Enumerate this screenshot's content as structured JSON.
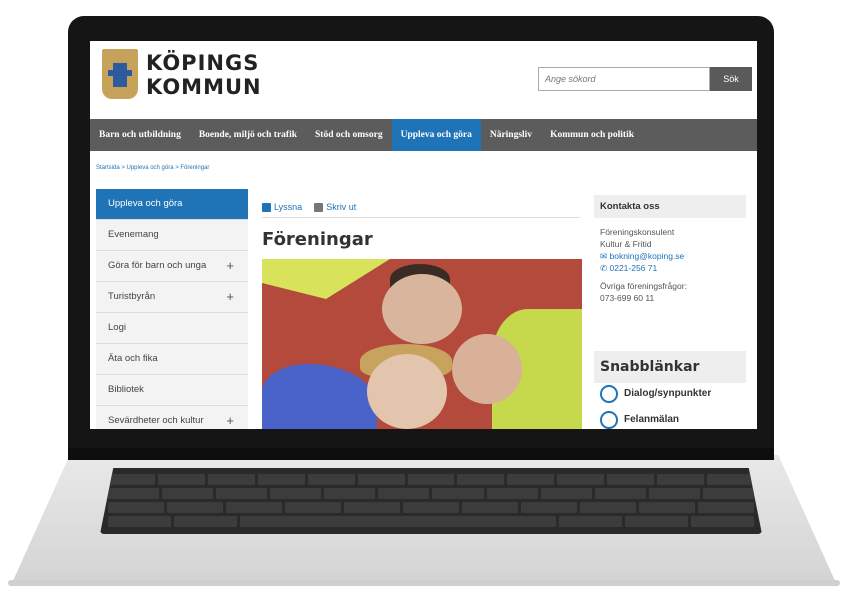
{
  "header": {
    "logo_line1": "KÖPINGS",
    "logo_line2": "KOMMUN",
    "search_placeholder": "Ange sökord",
    "search_button": "Sök"
  },
  "nav": [
    {
      "label": "Barn och utbildning",
      "active": false
    },
    {
      "label": "Boende, miljö och trafik",
      "active": false
    },
    {
      "label": "Stöd och omsorg",
      "active": false
    },
    {
      "label": "Uppleva och göra",
      "active": true
    },
    {
      "label": "Näringsliv",
      "active": false
    },
    {
      "label": "Kommun och politik",
      "active": false
    }
  ],
  "breadcrumb": "Startsida > Uppleva och göra > Föreningar",
  "sidebar": [
    {
      "label": "Uppleva och göra",
      "active": true,
      "expand": false
    },
    {
      "label": "Evenemang",
      "active": false,
      "expand": false
    },
    {
      "label": "Göra för barn och unga",
      "active": false,
      "expand": true
    },
    {
      "label": "Turistbyrån",
      "active": false,
      "expand": true
    },
    {
      "label": "Logi",
      "active": false,
      "expand": false
    },
    {
      "label": "Äta och fika",
      "active": false,
      "expand": false
    },
    {
      "label": "Bibliotek",
      "active": false,
      "expand": false
    },
    {
      "label": "Sevärdheter och kultur",
      "active": false,
      "expand": true
    }
  ],
  "tools": {
    "listen": "Lyssna",
    "print": "Skriv ut"
  },
  "main": {
    "title": "Föreningar"
  },
  "contact": {
    "heading": "Kontakta oss",
    "name": "Föreningskonsulent",
    "dept": "Kultur & Fritid",
    "email": "bokning@koping.se",
    "phone": "0221-256 71",
    "other_label": "Övriga föreningsfrågor:",
    "other_phone": "073-699 60 11"
  },
  "quicklinks": {
    "heading": "Snabblänkar",
    "items": [
      "Dialog/synpunkter",
      "Felanmälan"
    ]
  },
  "colors": {
    "accent": "#1f73b7",
    "nav": "#5c5c5c"
  }
}
